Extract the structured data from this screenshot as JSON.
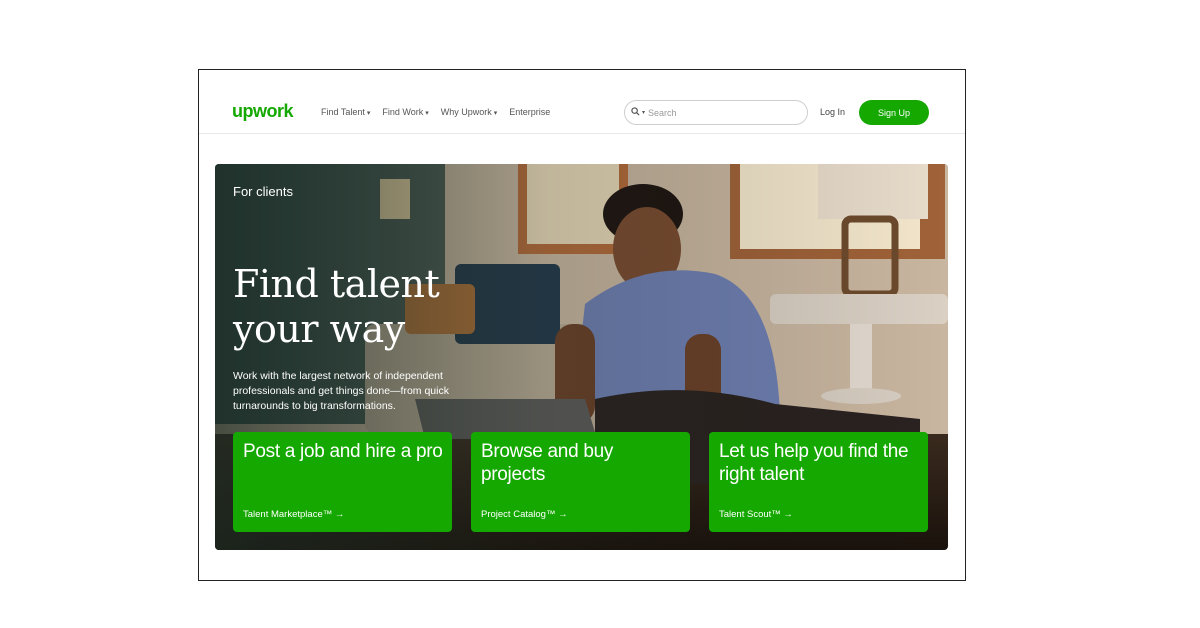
{
  "nav": {
    "logo": "upwork",
    "menu": [
      {
        "label": "Find Talent"
      },
      {
        "label": "Find Work"
      },
      {
        "label": "Why Upwork"
      },
      {
        "label": "Enterprise"
      }
    ],
    "caret": "▾",
    "search_icon": "🔍",
    "search_placeholder": "Search",
    "login": "Log In",
    "signup": "Sign Up"
  },
  "hero": {
    "eyebrow": "For clients",
    "headline_line1": "Find talent",
    "headline_line2": "your way",
    "subtext": "Work with the largest network of independent professionals and get things done—from quick turnarounds to big transformations."
  },
  "cards": [
    {
      "title": "Post a job and hire a pro",
      "link": "Talent Marketplace™ →"
    },
    {
      "title": "Browse and buy projects",
      "link": "Project Catalog™ →"
    },
    {
      "title": "Let us help you find the right talent",
      "link": "Talent Scout™ →"
    }
  ],
  "colors": {
    "brand": "#14a800"
  }
}
